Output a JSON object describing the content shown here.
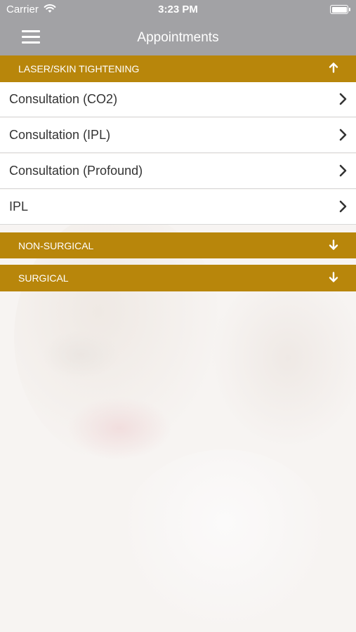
{
  "status_bar": {
    "carrier": "Carrier",
    "time": "3:23 PM"
  },
  "nav": {
    "title": "Appointments"
  },
  "sections": [
    {
      "label": "LASER/SKIN TIGHTENING",
      "expanded": true,
      "icon": "arrow-up-icon",
      "items": [
        {
          "label": "Consultation (CO2)"
        },
        {
          "label": "Consultation (IPL)"
        },
        {
          "label": "Consultation (Profound)"
        },
        {
          "label": "IPL"
        }
      ]
    },
    {
      "label": "NON-SURGICAL",
      "expanded": false,
      "icon": "arrow-down-icon"
    },
    {
      "label": "SURGICAL",
      "expanded": false,
      "icon": "arrow-down-icon"
    }
  ],
  "colors": {
    "nav_bar": "#a2a2a5",
    "section_header": "#b8860b"
  }
}
